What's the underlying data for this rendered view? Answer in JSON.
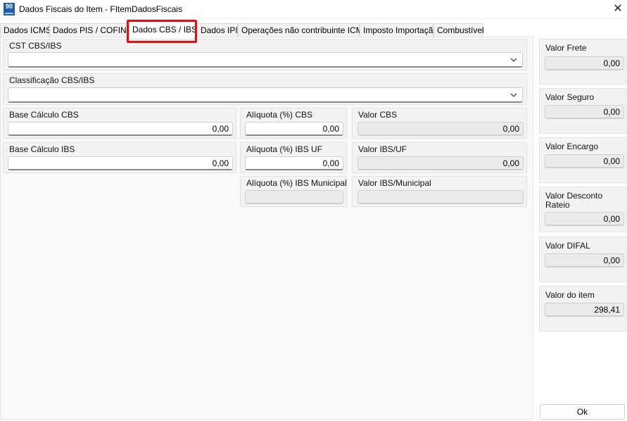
{
  "window": {
    "icon_label": "90",
    "title": "Dados Fiscais do Item - FItemDadosFiscais"
  },
  "tabs": [
    {
      "label": "Dados ICMS"
    },
    {
      "label": "Dados PIS / COFINS"
    },
    {
      "label": "Dados CBS / IBS"
    },
    {
      "label": "Dados IPI"
    },
    {
      "label": "Operações não contribuinte ICMS"
    },
    {
      "label": "Imposto Importação"
    },
    {
      "label": "Combustível"
    }
  ],
  "active_tab": "Dados CBS / IBS",
  "cbs_ibs": {
    "cst": {
      "label": "CST CBS/IBS",
      "value": ""
    },
    "classificacao": {
      "label": "Classificação CBS/IBS",
      "value": ""
    },
    "base_cbs": {
      "label": "Base Cálculo CBS",
      "value": "0,00"
    },
    "aliquota_cbs": {
      "label": "Alíquota (%) CBS",
      "value": "0,00"
    },
    "valor_cbs": {
      "label": "Valor CBS",
      "value": "0,00"
    },
    "base_ibs": {
      "label": "Base Cálculo IBS",
      "value": "0,00"
    },
    "aliquota_ibs_uf": {
      "label": "Alíquota (%) IBS UF",
      "value": "0,00"
    },
    "valor_ibs_uf": {
      "label": "Valor IBS/UF",
      "value": "0,00"
    },
    "aliquota_ibs_mun": {
      "label": "Alíquota (%) IBS Municipal",
      "value": ""
    },
    "valor_ibs_mun": {
      "label": "Valor IBS/Municipal",
      "value": ""
    }
  },
  "totals": {
    "frete": {
      "label": "Valor Frete",
      "value": "0,00"
    },
    "seguro": {
      "label": "Valor Seguro",
      "value": "0,00"
    },
    "encargo": {
      "label": "Valor Encargo",
      "value": "0,00"
    },
    "desconto": {
      "label": "Valor Desconto Rateio",
      "value": "0,00"
    },
    "difal": {
      "label": "Valor DIFAL",
      "value": "0,00"
    },
    "item": {
      "label": "Valor do item",
      "value": "298,41"
    }
  },
  "buttons": {
    "ok": "Ok"
  },
  "colors": {
    "highlight": "#e01010",
    "icon_bg": "#1f5fa8"
  }
}
